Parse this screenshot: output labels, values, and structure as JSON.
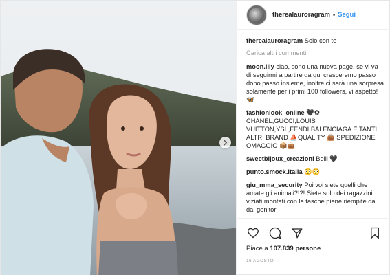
{
  "header": {
    "username": "therealauroragram",
    "separator": "•",
    "follow_label": "Segui"
  },
  "caption": {
    "username": "therealauroragram",
    "text": "Solo con te"
  },
  "load_more": "Carica altri commenti",
  "comments": [
    {
      "user": "moon.iily",
      "text": "ciao, sono una nuova page. se vi va di seguirmi a partire da qui cresceremo passo dopo passo insieme, inoltre ci sarà una sorpresa solamente per i primi 100 followers, vi aspetto! 🦋"
    },
    {
      "user": "fashionlook_online",
      "text": "🖤✿ CHANEL,GUCCI,LOUIS VUITTON,YSL,FENDI,BALENCIAGA E TANTI ALTRI BRAND ⛵QUALITY 👜 SPEDIZIONE OMAGGIO 📦👜"
    },
    {
      "user": "sweetbijoux_creazioni",
      "text": "Belli 🖤"
    },
    {
      "user": "punto.smock.italia",
      "text": "😳😳"
    },
    {
      "user": "giu_mma_security",
      "text": "Poi voi siete quelli che amate gli animali?!?! Siete solo dei ragazzini viziati montati con le tasche piene riempite da dai genitori"
    }
  ],
  "likes": {
    "prefix": "Piace a",
    "count": "107.839",
    "suffix": "persone"
  },
  "date": "16 agosto",
  "icons": [
    "heart-icon",
    "comment-icon",
    "share-icon",
    "bookmark-icon",
    "chevron-right-icon"
  ],
  "colors": {
    "link": "#3897f0",
    "muted": "#999999",
    "text": "#262626"
  }
}
